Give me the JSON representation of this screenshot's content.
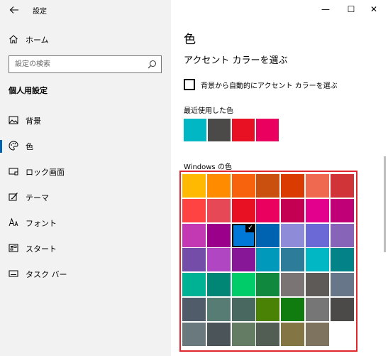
{
  "window": {
    "title": "設定",
    "controls": {
      "minimize": "—",
      "maximize": "☐",
      "close": "✕"
    }
  },
  "sidebar": {
    "home_label": "ホーム",
    "search_placeholder": "設定の検索",
    "section_title": "個人用設定",
    "items": [
      {
        "label": "背景",
        "icon": "image-icon",
        "selected": false
      },
      {
        "label": "色",
        "icon": "palette-icon",
        "selected": true
      },
      {
        "label": "ロック画面",
        "icon": "lock-screen-icon",
        "selected": false
      },
      {
        "label": "テーマ",
        "icon": "theme-icon",
        "selected": false
      },
      {
        "label": "フォント",
        "icon": "font-icon",
        "selected": false
      },
      {
        "label": "スタート",
        "icon": "start-icon",
        "selected": false
      },
      {
        "label": "タスク バー",
        "icon": "taskbar-icon",
        "selected": false
      }
    ]
  },
  "main": {
    "title": "色",
    "subheading": "アクセント カラーを選ぶ",
    "auto_accent_label": "背景から自動的にアクセント カラーを選ぶ",
    "auto_accent_checked": false,
    "recent_label": "最近使用した色",
    "recent_colors": [
      "#00b7c3",
      "#4c4a48",
      "#e81123",
      "#ea005e"
    ],
    "windows_colors_label": "Windows の色",
    "selected_color": "#0078d7",
    "windows_colors": [
      [
        "#ffb900",
        "#ff8c00",
        "#f7630c",
        "#ca5010",
        "#da3b01",
        "#ef6950",
        "#d13438"
      ],
      [
        "#ff4343",
        "#e74856",
        "#e81123",
        "#ea005e",
        "#c30052",
        "#e3008c",
        "#bf0077"
      ],
      [
        "#c239b3",
        "#9a0089",
        "#0078d7",
        "#0063b1",
        "#8e8cd8",
        "#6b69d6",
        "#8764b8"
      ],
      [
        "#744da9",
        "#b146c2",
        "#881798",
        "#0099bc",
        "#2d7d9a",
        "#00b7c3",
        "#038387"
      ],
      [
        "#00b294",
        "#018574",
        "#00cc6a",
        "#10893e",
        "#7a7574",
        "#5d5a58",
        "#68768a"
      ],
      [
        "#515c6b",
        "#567c73",
        "#486860",
        "#498205",
        "#107c10",
        "#767676",
        "#4c4a48"
      ],
      [
        "#69797e",
        "#4a5459",
        "#647c64",
        "#525e54",
        "#847545",
        "#7e735f",
        "#ffffff"
      ]
    ]
  }
}
